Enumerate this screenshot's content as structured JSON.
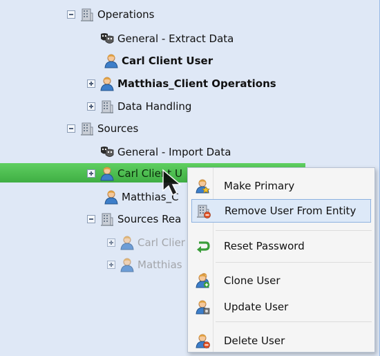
{
  "tree": {
    "items": [
      {
        "label": "Operations",
        "icon": "building-icon",
        "expander": "minus",
        "style": "normal"
      },
      {
        "label": "General - Extract Data",
        "icon": "mask-icon",
        "expander": "none",
        "style": "normal"
      },
      {
        "label": "Carl Client User",
        "icon": "user-icon",
        "expander": "none",
        "style": "bold"
      },
      {
        "label": "Matthias_Client Operations",
        "icon": "user-icon",
        "expander": "plus",
        "style": "bold"
      },
      {
        "label": "Data Handling",
        "icon": "building-icon",
        "expander": "plus",
        "style": "normal"
      },
      {
        "label": "Sources",
        "icon": "building-icon",
        "expander": "minus",
        "style": "normal"
      },
      {
        "label": "General - Import Data",
        "icon": "mask-icon",
        "expander": "none",
        "style": "normal"
      },
      {
        "label": "Carl Client U",
        "icon": "user-icon",
        "expander": "plus",
        "style": "selected"
      },
      {
        "label": "Matthias_C",
        "icon": "user-icon",
        "expander": "none",
        "style": "normal"
      },
      {
        "label": "Sources Rea",
        "icon": "building-icon",
        "expander": "minus",
        "style": "normal"
      },
      {
        "label": "Carl Clier",
        "icon": "user-icon",
        "expander": "plus",
        "style": "disabled"
      },
      {
        "label": "Matthias",
        "icon": "user-icon",
        "expander": "plus",
        "style": "disabled"
      }
    ]
  },
  "context_menu": {
    "items": [
      {
        "label": "Make Primary",
        "icon": "user-star-icon"
      },
      {
        "label": "Remove User From Entity",
        "icon": "building-remove-icon"
      },
      {
        "label": "Reset Password",
        "icon": "reset-arrow-icon"
      },
      {
        "label": "Clone User",
        "icon": "clone-user-icon"
      },
      {
        "label": "Update User",
        "icon": "update-user-icon"
      },
      {
        "label": "Delete User",
        "icon": "delete-user-icon"
      }
    ]
  },
  "colors": {
    "tree_background": "#dfe8f6",
    "selection": "#4cbf50",
    "menu_background": "#f5f5f5",
    "menu_active": "#dde9f8"
  }
}
